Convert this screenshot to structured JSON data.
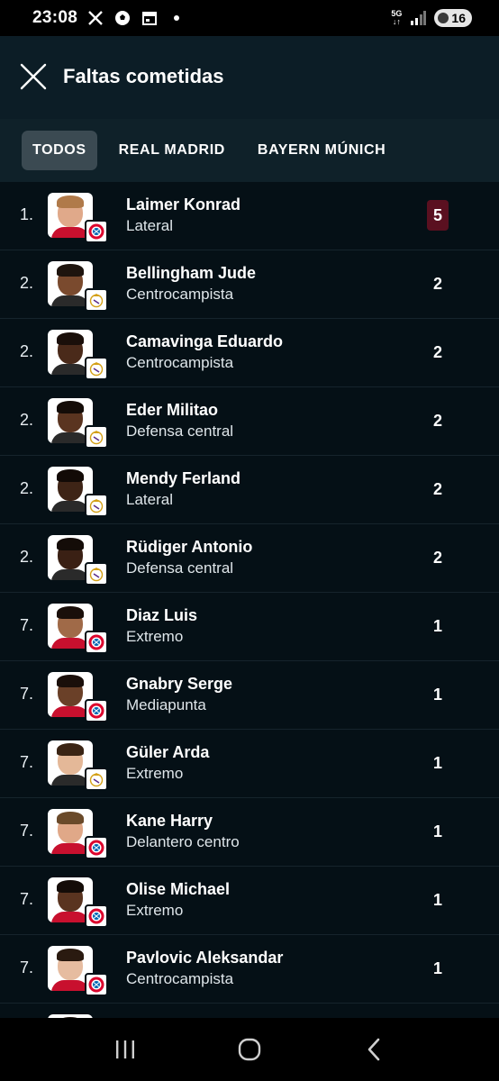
{
  "status_bar": {
    "time": "23:08",
    "network": "5G",
    "battery": "16",
    "icons": [
      "x-logo-icon",
      "soccer-ball-icon",
      "calendar-icon",
      "dot-icon",
      "network-5g-icon",
      "signal-icon",
      "battery-icon"
    ]
  },
  "header": {
    "title": "Faltas cometidas",
    "close_icon": "close-icon"
  },
  "tabs": [
    {
      "label": "TODOS",
      "active": true
    },
    {
      "label": "REAL MADRID",
      "active": false
    },
    {
      "label": "BAYERN MÚNICH",
      "active": false
    }
  ],
  "players": [
    {
      "rank": "1.",
      "name": "Laimer Konrad",
      "position": "Lateral",
      "value": "5",
      "team": "bayern",
      "highlight": true,
      "skin": "#e0a98a",
      "hair": "#b07a4a",
      "shirt": "#c8102e"
    },
    {
      "rank": "2.",
      "name": "Bellingham Jude",
      "position": "Centrocampista",
      "value": "2",
      "team": "real",
      "highlight": false,
      "skin": "#7a4a2e",
      "hair": "#1e140e",
      "shirt": "#2a2a2a"
    },
    {
      "rank": "2.",
      "name": "Camavinga Eduardo",
      "position": "Centrocampista",
      "value": "2",
      "team": "real",
      "highlight": false,
      "skin": "#4a2a1a",
      "hair": "#1a0f0a",
      "shirt": "#2a2a2a"
    },
    {
      "rank": "2.",
      "name": "Eder Militao",
      "position": "Defensa central",
      "value": "2",
      "team": "real",
      "highlight": false,
      "skin": "#5a3420",
      "hair": "#140c08",
      "shirt": "#2a2a2a"
    },
    {
      "rank": "2.",
      "name": "Mendy Ferland",
      "position": "Lateral",
      "value": "2",
      "team": "real",
      "highlight": false,
      "skin": "#3e2416",
      "hair": "#120a06",
      "shirt": "#2a2a2a"
    },
    {
      "rank": "2.",
      "name": "Rüdiger Antonio",
      "position": "Defensa central",
      "value": "2",
      "team": "real",
      "highlight": false,
      "skin": "#3a2014",
      "hair": "#140c08",
      "shirt": "#2a2a2a"
    },
    {
      "rank": "7.",
      "name": "Diaz Luis",
      "position": "Extremo",
      "value": "1",
      "team": "bayern",
      "highlight": false,
      "skin": "#a06a48",
      "hair": "#1a0f0a",
      "shirt": "#c8102e"
    },
    {
      "rank": "7.",
      "name": "Gnabry Serge",
      "position": "Mediapunta",
      "value": "1",
      "team": "bayern",
      "highlight": false,
      "skin": "#6a4028",
      "hair": "#1a0f0a",
      "shirt": "#c8102e"
    },
    {
      "rank": "7.",
      "name": "Güler Arda",
      "position": "Extremo",
      "value": "1",
      "team": "real",
      "highlight": false,
      "skin": "#e4b898",
      "hair": "#3a2414",
      "shirt": "#2a2a2a"
    },
    {
      "rank": "7.",
      "name": "Kane Harry",
      "position": "Delantero centro",
      "value": "1",
      "team": "bayern",
      "highlight": false,
      "skin": "#e0a888",
      "hair": "#6a4a2a",
      "shirt": "#c8102e"
    },
    {
      "rank": "7.",
      "name": "Olise Michael",
      "position": "Extremo",
      "value": "1",
      "team": "bayern",
      "highlight": false,
      "skin": "#5a3420",
      "hair": "#140c08",
      "shirt": "#c8102e"
    },
    {
      "rank": "7.",
      "name": "Pavlovic Aleksandar",
      "position": "Centrocampista",
      "value": "1",
      "team": "bayern",
      "highlight": false,
      "skin": "#e6bca0",
      "hair": "#2a1a10",
      "shirt": "#c8102e"
    },
    {
      "rank": "",
      "name": "",
      "position": "",
      "value": "",
      "team": "real",
      "highlight": false,
      "skin": "#c08a6a",
      "hair": "#1a0f0a",
      "shirt": "#2a2a2a"
    }
  ],
  "nav": {
    "recents": "recents-icon",
    "home": "home-icon",
    "back": "back-icon"
  }
}
